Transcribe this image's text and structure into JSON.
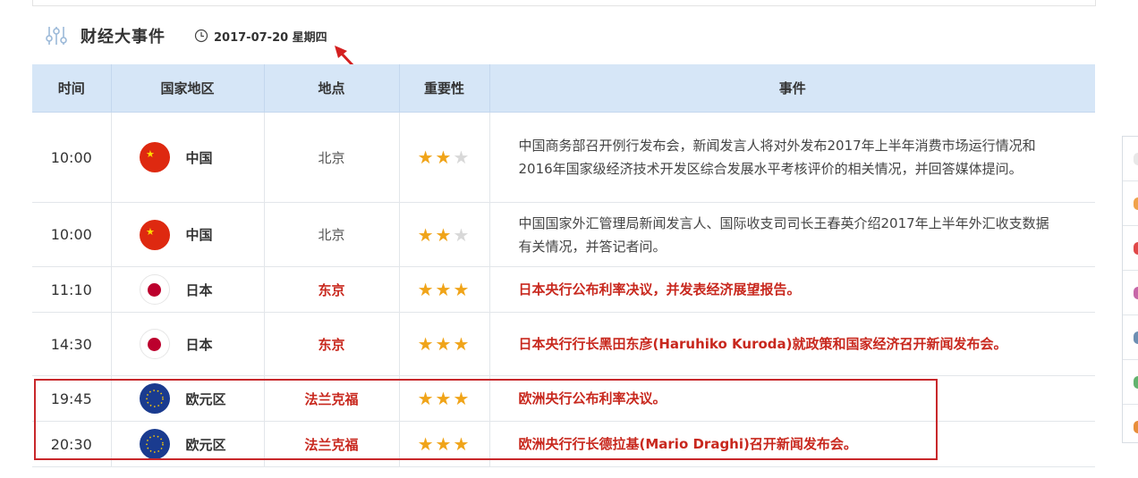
{
  "header": {
    "title": "财经大事件",
    "date": "2017-07-20 星期四"
  },
  "table": {
    "columns": [
      "时间",
      "国家地区",
      "地点",
      "重要性",
      "事件"
    ],
    "rows": [
      {
        "time": "10:00",
        "country": "中国",
        "flag": "china-flag",
        "location": "北京",
        "stars": 2,
        "event": "中国商务部召开例行发布会，新闻发言人将对外发布2017年上半年消费市场运行情况和2016年国家级经济技术开发区综合发展水平考核评价的相关情况，并回答媒体提问。",
        "highlight": false
      },
      {
        "time": "10:00",
        "country": "中国",
        "flag": "china-flag",
        "location": "北京",
        "stars": 2,
        "event": "中国国家外汇管理局新闻发言人、国际收支司司长王春英介绍2017年上半年外汇收支数据有关情况，并答记者问。",
        "highlight": false
      },
      {
        "time": "11:10",
        "country": "日本",
        "flag": "japan-flag",
        "location": "东京",
        "stars": 3,
        "event": "日本央行公布利率决议，并发表经济展望报告。",
        "highlight": true
      },
      {
        "time": "14:30",
        "country": "日本",
        "flag": "japan-flag",
        "location": "东京",
        "stars": 3,
        "event": "日本央行行长黑田东彦(Haruhiko Kuroda)就政策和国家经济召开新闻发布会。",
        "highlight": true
      },
      {
        "time": "19:45",
        "country": "欧元区",
        "flag": "eu-flag",
        "location": "法兰克福",
        "stars": 3,
        "event": "欧洲央行公布利率决议。",
        "highlight": true
      },
      {
        "time": "20:30",
        "country": "欧元区",
        "flag": "eu-flag",
        "location": "法兰克福",
        "stars": 3,
        "event": "欧洲央行行长德拉基(Mario Draghi)召开新闻发布会。",
        "highlight": true
      }
    ]
  },
  "colors": {
    "header_bg": "#d6e6f7",
    "highlight_red": "#c8281e",
    "star_on": "#f0a419",
    "star_off": "#d8d8d8",
    "annotation_red": "#c8282b"
  },
  "side_widget": {
    "dot_colors": [
      "#e8e8e8",
      "#f0a24a",
      "#e04848",
      "#c766a8",
      "#6d8fb3",
      "#62b36e",
      "#e88e3a"
    ]
  }
}
